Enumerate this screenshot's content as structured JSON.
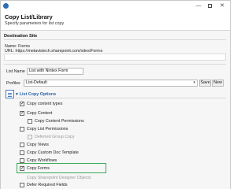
{
  "window": {
    "minimize_glyph": "—",
    "close_glyph": "✕"
  },
  "header": {
    "title": "Copy List/Library",
    "subtitle": "Specify parameters for list copy"
  },
  "destination": {
    "section_title": "Destination Site",
    "name_line": "Name: Forms",
    "url_line": "URL: https://metavistech.sharepoint.com/sites/Forms"
  },
  "list_name": {
    "label": "List Name",
    "value": "List with Nintex Form"
  },
  "profiles": {
    "label": "Profiles",
    "selected": "List-Default",
    "save_label": "Save",
    "new_label": "New"
  },
  "options": {
    "header": "List Copy Options",
    "items": [
      {
        "label": "Copy content types",
        "checked": true,
        "enabled": true
      },
      {
        "label": "Copy Content",
        "checked": true,
        "enabled": true
      },
      {
        "label": "Copy Content Permissions",
        "checked": false,
        "enabled": true
      },
      {
        "label": "Copy List Permissions",
        "checked": false,
        "enabled": true
      },
      {
        "label": "Deferred Group Copy",
        "checked": false,
        "enabled": false
      },
      {
        "label": "Copy Views",
        "checked": false,
        "enabled": true
      },
      {
        "label": "Copy Custom Doc Template",
        "checked": false,
        "enabled": true
      },
      {
        "label": "Copy Workflows",
        "checked": false,
        "enabled": true
      },
      {
        "label": "Copy Forms",
        "checked": true,
        "enabled": true
      },
      {
        "label": "Copy Sharepoint Designer Objects",
        "checked": false,
        "enabled": false
      },
      {
        "label": "Defer Required Fields",
        "checked": false,
        "enabled": true
      }
    ]
  },
  "colors": {
    "accent": "#2c63ad",
    "highlight": "#3da85c"
  }
}
